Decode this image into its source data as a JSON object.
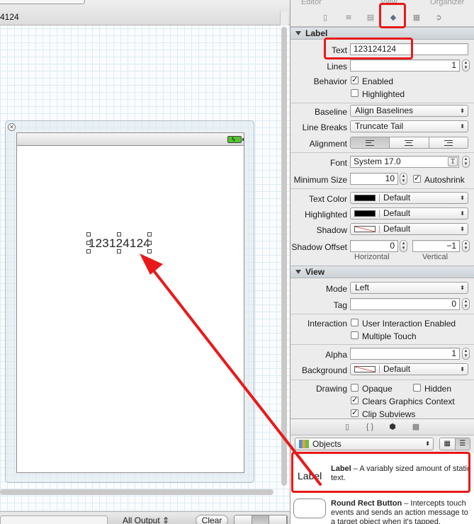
{
  "document": {
    "title_fragment": "4124"
  },
  "toolbar": {
    "editor_label": "Editor",
    "view_label": "View",
    "organizer_label": "Organizer"
  },
  "canvas": {
    "label_text": "123124124",
    "debug": {
      "output_selector": "All Output",
      "clear_label": "Clear"
    }
  },
  "inspector": {
    "label_section": {
      "title": "Label",
      "text_label": "Text",
      "text_value": "123124124",
      "lines_label": "Lines",
      "lines_value": "1",
      "behavior_label": "Behavior",
      "enabled_label": "Enabled",
      "enabled_checked": true,
      "highlighted_label": "Highlighted",
      "highlighted_checked": false,
      "baseline_label": "Baseline",
      "baseline_value": "Align Baselines",
      "line_breaks_label": "Line Breaks",
      "line_breaks_value": "Truncate Tail",
      "alignment_label": "Alignment",
      "alignment_selected": "left",
      "font_label": "Font",
      "font_value": "System 17.0",
      "min_size_label": "Minimum Size",
      "min_size_value": "10",
      "autoshrink_label": "Autoshrink",
      "autoshrink_checked": true,
      "text_color_label": "Text Color",
      "text_color_value": "Default",
      "highlighted_color_label": "Highlighted",
      "highlighted_color_value": "Default",
      "shadow_label": "Shadow",
      "shadow_value": "Default",
      "shadow_offset_label": "Shadow Offset",
      "shadow_offset_h": "0",
      "shadow_offset_v": "−1",
      "horizontal_label": "Horizontal",
      "vertical_label": "Vertical"
    },
    "view_section": {
      "title": "View",
      "mode_label": "Mode",
      "mode_value": "Left",
      "tag_label": "Tag",
      "tag_value": "0",
      "interaction_label": "Interaction",
      "user_interaction_label": "User Interaction Enabled",
      "user_interaction_checked": false,
      "multiple_touch_label": "Multiple Touch",
      "multiple_touch_checked": false,
      "alpha_label": "Alpha",
      "alpha_value": "1",
      "background_label": "Background",
      "background_value": "Default",
      "drawing_label": "Drawing",
      "opaque_label": "Opaque",
      "opaque_checked": false,
      "hidden_label": "Hidden",
      "hidden_checked": false,
      "clears_label": "Clears Graphics Context",
      "clears_checked": true,
      "clip_label": "Clip Subviews",
      "clip_checked": true
    },
    "library": {
      "objects_popup": "Objects",
      "items": [
        {
          "thumb": "Label",
          "name": "Label",
          "description": " – A variably sized amount of static text."
        },
        {
          "thumb": "",
          "name": "Round Rect Button",
          "description": " – Intercepts touch events and sends an action message to a target object when it's tapped."
        }
      ]
    }
  },
  "colors": {
    "annotation_red": "#e8191a",
    "battery_green": "#55c32c"
  }
}
